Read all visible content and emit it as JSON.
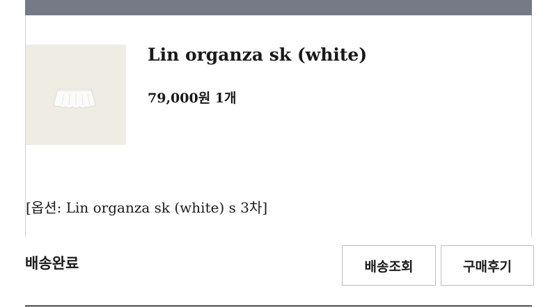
{
  "order_item": {
    "product_name": "Lin organza sk (white)",
    "price_quantity": "79,000원 1개",
    "option_text": "[옵션: Lin organza sk (white) s 3차]",
    "thumbnail_icon": "skirt-image"
  },
  "delivery": {
    "status": "배송완료",
    "tracking_button": "배송조회",
    "review_button": "구매후기"
  },
  "colors": {
    "header_bar": "#757b86",
    "thumbnail_bg": "#efece4"
  }
}
